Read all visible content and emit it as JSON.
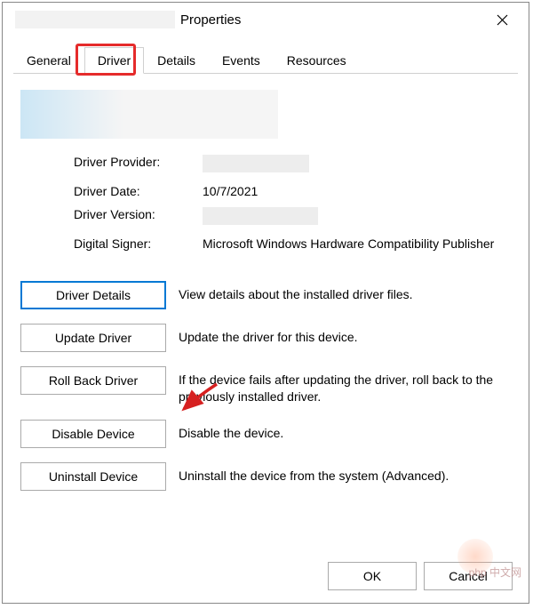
{
  "window": {
    "title_suffix": "Properties"
  },
  "tabs": [
    {
      "label": "General"
    },
    {
      "label": "Driver",
      "active": true,
      "highlighted": true
    },
    {
      "label": "Details"
    },
    {
      "label": "Events"
    },
    {
      "label": "Resources"
    }
  ],
  "driver_info": {
    "provider_label": "Driver Provider:",
    "date_label": "Driver Date:",
    "date_value": "10/7/2021",
    "version_label": "Driver Version:",
    "signer_label": "Digital Signer:",
    "signer_value": "Microsoft Windows Hardware Compatibility Publisher"
  },
  "actions": {
    "details": {
      "label": "Driver Details",
      "desc": "View details about the installed driver files."
    },
    "update": {
      "label": "Update Driver",
      "desc": "Update the driver for this device."
    },
    "rollback": {
      "label": "Roll Back Driver",
      "desc": "If the device fails after updating the driver, roll back to the previously installed driver."
    },
    "disable": {
      "label": "Disable Device",
      "desc": "Disable the device."
    },
    "uninstall": {
      "label": "Uninstall Device",
      "desc": "Uninstall the device from the system (Advanced)."
    }
  },
  "footer": {
    "ok": "OK",
    "cancel": "Cancel"
  },
  "watermark": "php 中文网"
}
